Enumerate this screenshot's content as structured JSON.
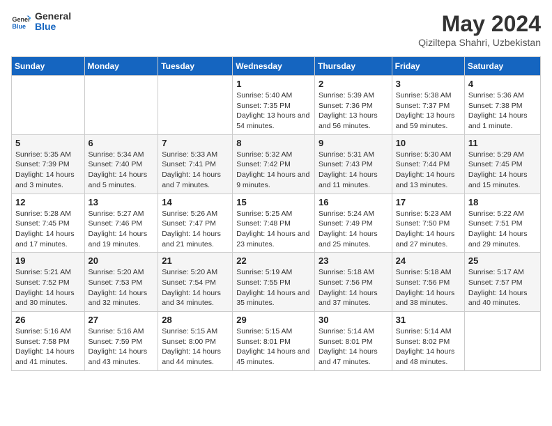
{
  "header": {
    "logo_line1": "General",
    "logo_line2": "Blue",
    "title": "May 2024",
    "subtitle": "Qiziltepa Shahri, Uzbekistan"
  },
  "calendar": {
    "days_of_week": [
      "Sunday",
      "Monday",
      "Tuesday",
      "Wednesday",
      "Thursday",
      "Friday",
      "Saturday"
    ],
    "weeks": [
      [
        {
          "day": "",
          "info": ""
        },
        {
          "day": "",
          "info": ""
        },
        {
          "day": "",
          "info": ""
        },
        {
          "day": "1",
          "info": "Sunrise: 5:40 AM\nSunset: 7:35 PM\nDaylight: 13 hours and 54 minutes."
        },
        {
          "day": "2",
          "info": "Sunrise: 5:39 AM\nSunset: 7:36 PM\nDaylight: 13 hours and 56 minutes."
        },
        {
          "day": "3",
          "info": "Sunrise: 5:38 AM\nSunset: 7:37 PM\nDaylight: 13 hours and 59 minutes."
        },
        {
          "day": "4",
          "info": "Sunrise: 5:36 AM\nSunset: 7:38 PM\nDaylight: 14 hours and 1 minute."
        }
      ],
      [
        {
          "day": "5",
          "info": "Sunrise: 5:35 AM\nSunset: 7:39 PM\nDaylight: 14 hours and 3 minutes."
        },
        {
          "day": "6",
          "info": "Sunrise: 5:34 AM\nSunset: 7:40 PM\nDaylight: 14 hours and 5 minutes."
        },
        {
          "day": "7",
          "info": "Sunrise: 5:33 AM\nSunset: 7:41 PM\nDaylight: 14 hours and 7 minutes."
        },
        {
          "day": "8",
          "info": "Sunrise: 5:32 AM\nSunset: 7:42 PM\nDaylight: 14 hours and 9 minutes."
        },
        {
          "day": "9",
          "info": "Sunrise: 5:31 AM\nSunset: 7:43 PM\nDaylight: 14 hours and 11 minutes."
        },
        {
          "day": "10",
          "info": "Sunrise: 5:30 AM\nSunset: 7:44 PM\nDaylight: 14 hours and 13 minutes."
        },
        {
          "day": "11",
          "info": "Sunrise: 5:29 AM\nSunset: 7:45 PM\nDaylight: 14 hours and 15 minutes."
        }
      ],
      [
        {
          "day": "12",
          "info": "Sunrise: 5:28 AM\nSunset: 7:45 PM\nDaylight: 14 hours and 17 minutes."
        },
        {
          "day": "13",
          "info": "Sunrise: 5:27 AM\nSunset: 7:46 PM\nDaylight: 14 hours and 19 minutes."
        },
        {
          "day": "14",
          "info": "Sunrise: 5:26 AM\nSunset: 7:47 PM\nDaylight: 14 hours and 21 minutes."
        },
        {
          "day": "15",
          "info": "Sunrise: 5:25 AM\nSunset: 7:48 PM\nDaylight: 14 hours and 23 minutes."
        },
        {
          "day": "16",
          "info": "Sunrise: 5:24 AM\nSunset: 7:49 PM\nDaylight: 14 hours and 25 minutes."
        },
        {
          "day": "17",
          "info": "Sunrise: 5:23 AM\nSunset: 7:50 PM\nDaylight: 14 hours and 27 minutes."
        },
        {
          "day": "18",
          "info": "Sunrise: 5:22 AM\nSunset: 7:51 PM\nDaylight: 14 hours and 29 minutes."
        }
      ],
      [
        {
          "day": "19",
          "info": "Sunrise: 5:21 AM\nSunset: 7:52 PM\nDaylight: 14 hours and 30 minutes."
        },
        {
          "day": "20",
          "info": "Sunrise: 5:20 AM\nSunset: 7:53 PM\nDaylight: 14 hours and 32 minutes."
        },
        {
          "day": "21",
          "info": "Sunrise: 5:20 AM\nSunset: 7:54 PM\nDaylight: 14 hours and 34 minutes."
        },
        {
          "day": "22",
          "info": "Sunrise: 5:19 AM\nSunset: 7:55 PM\nDaylight: 14 hours and 35 minutes."
        },
        {
          "day": "23",
          "info": "Sunrise: 5:18 AM\nSunset: 7:56 PM\nDaylight: 14 hours and 37 minutes."
        },
        {
          "day": "24",
          "info": "Sunrise: 5:18 AM\nSunset: 7:56 PM\nDaylight: 14 hours and 38 minutes."
        },
        {
          "day": "25",
          "info": "Sunrise: 5:17 AM\nSunset: 7:57 PM\nDaylight: 14 hours and 40 minutes."
        }
      ],
      [
        {
          "day": "26",
          "info": "Sunrise: 5:16 AM\nSunset: 7:58 PM\nDaylight: 14 hours and 41 minutes."
        },
        {
          "day": "27",
          "info": "Sunrise: 5:16 AM\nSunset: 7:59 PM\nDaylight: 14 hours and 43 minutes."
        },
        {
          "day": "28",
          "info": "Sunrise: 5:15 AM\nSunset: 8:00 PM\nDaylight: 14 hours and 44 minutes."
        },
        {
          "day": "29",
          "info": "Sunrise: 5:15 AM\nSunset: 8:01 PM\nDaylight: 14 hours and 45 minutes."
        },
        {
          "day": "30",
          "info": "Sunrise: 5:14 AM\nSunset: 8:01 PM\nDaylight: 14 hours and 47 minutes."
        },
        {
          "day": "31",
          "info": "Sunrise: 5:14 AM\nSunset: 8:02 PM\nDaylight: 14 hours and 48 minutes."
        },
        {
          "day": "",
          "info": ""
        }
      ]
    ]
  }
}
